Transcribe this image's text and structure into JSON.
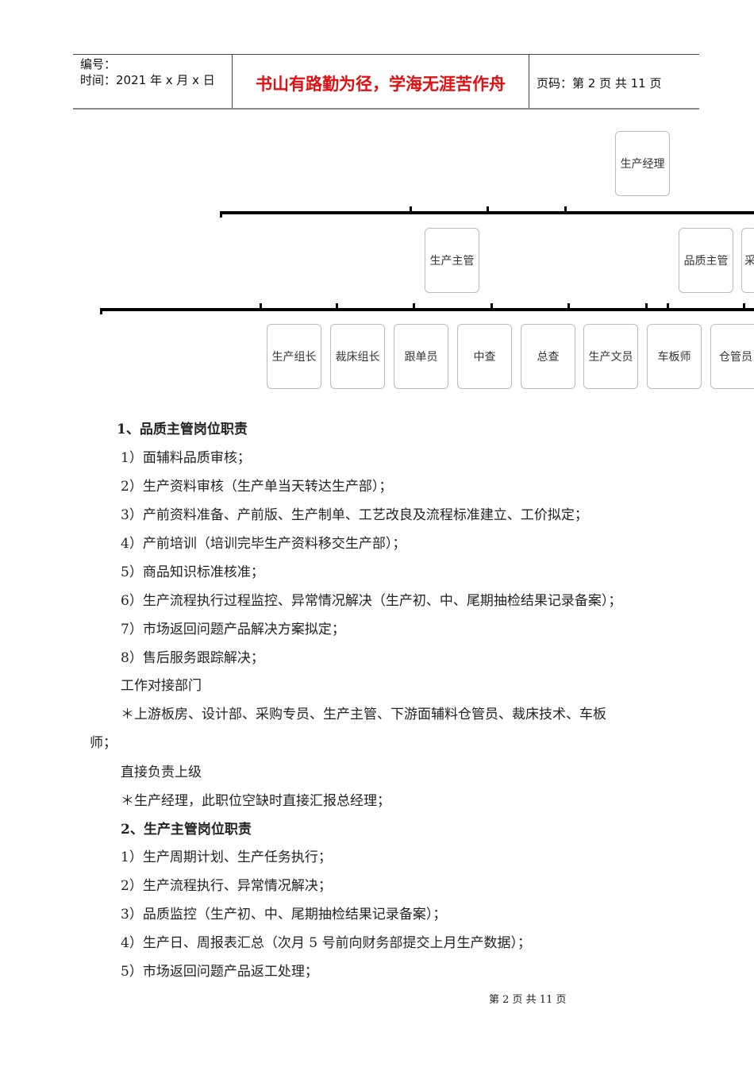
{
  "header": {
    "number_label": "编号：",
    "date_label": "时间：2021 年 x 月 x 日",
    "motto": "书山有路勤为径，学海无涯苦作舟",
    "page_label": "页码：第 2 页  共 11 页"
  },
  "org_chart": {
    "top": "生产经理",
    "middle": [
      "生产主管",
      "品质主管",
      "采"
    ],
    "bottom": [
      "生产组长",
      "裁床组长",
      "跟单员",
      "中查",
      "总查",
      "生产文员",
      "车板师",
      "仓管员"
    ]
  },
  "body": {
    "lines": [
      "1、品质主管岗位职责",
      "1）面辅料品质审核；",
      "2）生产资料审核（生产单当天转达生产部）；",
      "3）产前资料准备、产前版、生产制单、工艺改良及流程标准建立、工价拟定；",
      "4）产前培训（培训完毕生产资料移交生产部）；",
      "5）商品知识标准核准；",
      "6）生产流程执行过程监控、异常情况解决（生产初、中、尾期抽检结果记录备案）；",
      "7）市场返回问题产品解决方案拟定；",
      "8）售后服务跟踪解决；",
      "工作对接部门",
      "＊上游板房、设计部、采购专员、生产主管、下游面辅料仓管员、裁床技术、车板",
      "师；",
      "直接负责上级",
      "＊生产经理，此职位空缺时直接汇报总经理；",
      "2、生产主管岗位职责",
      "1）生产周期计划、生产任务执行；",
      "2）生产流程执行、异常情况解决；",
      "3）品质监控（生产初、中、尾期抽检结果记录备案）；",
      "4）生产日、周报表汇总（次月 5 号前向财务部提交上月生产数据）；",
      "5）市场返回问题产品返工处理；"
    ]
  },
  "footer": {
    "page": "第  2  页  共  11  页"
  }
}
